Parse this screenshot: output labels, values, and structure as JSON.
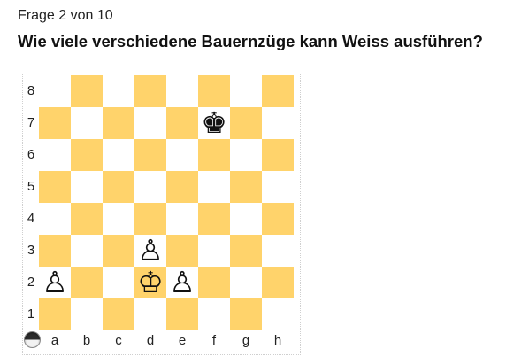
{
  "quiz": {
    "counter": "Frage 2 von 10",
    "question": "Wie viele verschiedene Bauernzüge kann Weiss ausführen?"
  },
  "board": {
    "colors": {
      "dark": "#ffd36b",
      "light": "#ffffff"
    },
    "files": [
      "a",
      "b",
      "c",
      "d",
      "e",
      "f",
      "g",
      "h"
    ],
    "ranks": [
      "8",
      "7",
      "6",
      "5",
      "4",
      "3",
      "2",
      "1"
    ],
    "pieces": [
      {
        "square": "f7",
        "color": "black",
        "type": "king",
        "glyph": "♚"
      },
      {
        "square": "d3",
        "color": "white",
        "type": "pawn",
        "glyph": "♙"
      },
      {
        "square": "a2",
        "color": "white",
        "type": "pawn",
        "glyph": "♙"
      },
      {
        "square": "d2",
        "color": "white",
        "type": "king",
        "glyph": "♔"
      },
      {
        "square": "e2",
        "color": "white",
        "type": "pawn",
        "glyph": "♙"
      }
    ],
    "turn_indicator_icon": "half-black-half-white-circle"
  }
}
